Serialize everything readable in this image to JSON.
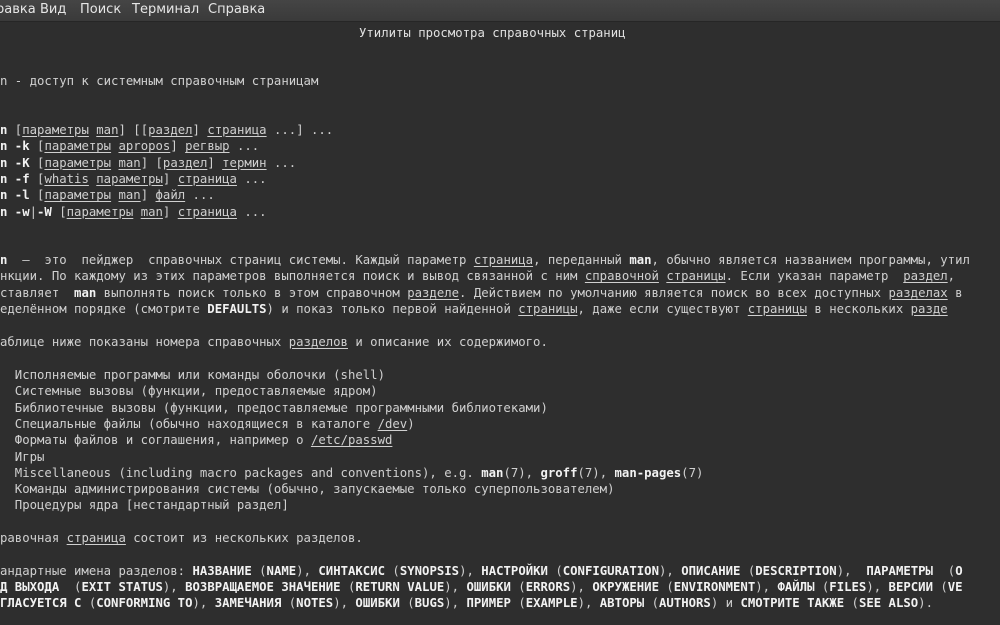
{
  "menu": {
    "items": [
      "равка",
      "Вид",
      "Поиск",
      "Терминал",
      "Справка"
    ]
  },
  "man": {
    "title": "Утилиты просмотра справочных страниц",
    "name_line": [
      {
        "t": "n - доступ к системным справочным страницам"
      }
    ],
    "synopsis": [
      [
        {
          "t": "n",
          "s": "b"
        },
        {
          "t": " ["
        },
        {
          "t": "параметры",
          "s": "u"
        },
        {
          "t": " "
        },
        {
          "t": "man",
          "s": "u"
        },
        {
          "t": "] [["
        },
        {
          "t": "раздел",
          "s": "u"
        },
        {
          "t": "] "
        },
        {
          "t": "страница",
          "s": "u"
        },
        {
          "t": " ...] ..."
        }
      ],
      [
        {
          "t": "n -k",
          "s": "b"
        },
        {
          "t": " ["
        },
        {
          "t": "параметры",
          "s": "u"
        },
        {
          "t": " "
        },
        {
          "t": "apropos",
          "s": "u"
        },
        {
          "t": "] "
        },
        {
          "t": "регвыр",
          "s": "u"
        },
        {
          "t": " ..."
        }
      ],
      [
        {
          "t": "n -K",
          "s": "b"
        },
        {
          "t": " ["
        },
        {
          "t": "параметры",
          "s": "u"
        },
        {
          "t": " "
        },
        {
          "t": "man",
          "s": "u"
        },
        {
          "t": "] ["
        },
        {
          "t": "раздел",
          "s": "u"
        },
        {
          "t": "] "
        },
        {
          "t": "термин",
          "s": "u"
        },
        {
          "t": " ..."
        }
      ],
      [
        {
          "t": "n -f",
          "s": "b"
        },
        {
          "t": " ["
        },
        {
          "t": "whatis",
          "s": "u"
        },
        {
          "t": " "
        },
        {
          "t": "параметры",
          "s": "u"
        },
        {
          "t": "] "
        },
        {
          "t": "страница",
          "s": "u"
        },
        {
          "t": " ..."
        }
      ],
      [
        {
          "t": "n -l",
          "s": "b"
        },
        {
          "t": " ["
        },
        {
          "t": "параметры",
          "s": "u"
        },
        {
          "t": " "
        },
        {
          "t": "man",
          "s": "u"
        },
        {
          "t": "] "
        },
        {
          "t": "файл",
          "s": "u"
        },
        {
          "t": " ..."
        }
      ],
      [
        {
          "t": "n -w",
          "s": "b"
        },
        {
          "t": "|"
        },
        {
          "t": "-W",
          "s": "b"
        },
        {
          "t": " ["
        },
        {
          "t": "параметры",
          "s": "u"
        },
        {
          "t": " "
        },
        {
          "t": "man",
          "s": "u"
        },
        {
          "t": "] "
        },
        {
          "t": "страница",
          "s": "u"
        },
        {
          "t": " ..."
        }
      ]
    ],
    "description": [
      [
        {
          "t": "n",
          "s": "b"
        },
        {
          "t": "  —  это  пейджер  справочных страниц системы. Каждый параметр "
        },
        {
          "t": "страница",
          "s": "u"
        },
        {
          "t": ", переданный "
        },
        {
          "t": "man",
          "s": "b"
        },
        {
          "t": ", обычно является названием программы, утил"
        }
      ],
      [
        {
          "t": "нкции. По каждому из этих параметров выполняется поиск и вывод связанной с ним "
        },
        {
          "t": "справочной",
          "s": "u"
        },
        {
          "t": " "
        },
        {
          "t": "страницы",
          "s": "u"
        },
        {
          "t": ". Если указан параметр  "
        },
        {
          "t": "раздел",
          "s": "u"
        },
        {
          "t": ", "
        }
      ],
      [
        {
          "t": "ставляет  "
        },
        {
          "t": "man",
          "s": "b"
        },
        {
          "t": " выполнять поиск только в этом справочном "
        },
        {
          "t": "разделе",
          "s": "u"
        },
        {
          "t": ". Действием по умолчанию является поиск во всех доступных "
        },
        {
          "t": "разделах",
          "s": "u"
        },
        {
          "t": " в"
        }
      ],
      [
        {
          "t": "еделённом порядке (смотрите "
        },
        {
          "t": "DEFAULTS",
          "s": "b"
        },
        {
          "t": ") и показ только первой найденной "
        },
        {
          "t": "страницы",
          "s": "u"
        },
        {
          "t": ", даже если существуют "
        },
        {
          "t": "страницы",
          "s": "u"
        },
        {
          "t": " в нескольких "
        },
        {
          "t": "разде",
          "s": "u"
        }
      ],
      [],
      [
        {
          "t": "аблице ниже показаны номера справочных "
        },
        {
          "t": "разделов",
          "s": "u"
        },
        {
          "t": " и описание их содержимого."
        }
      ]
    ],
    "sections": [
      [
        {
          "t": "  Исполняемые программы или команды оболочки (shell)"
        }
      ],
      [
        {
          "t": "  Системные вызовы (функции, предоставляемые ядром)"
        }
      ],
      [
        {
          "t": "  Библиотечные вызовы (функции, предоставляемые программными библиотеками)"
        }
      ],
      [
        {
          "t": "  Специальные файлы (обычно находящиеся в каталоге "
        },
        {
          "t": "/dev",
          "s": "u"
        },
        {
          "t": ")"
        }
      ],
      [
        {
          "t": "  Форматы файлов и соглашения, например о "
        },
        {
          "t": "/etc/passwd",
          "s": "u"
        }
      ],
      [
        {
          "t": "  Игры"
        }
      ],
      [
        {
          "t": "  Miscellaneous (including macro packages and conventions), e.g. "
        },
        {
          "t": "man",
          "s": "b"
        },
        {
          "t": "(7), "
        },
        {
          "t": "groff",
          "s": "b"
        },
        {
          "t": "(7), "
        },
        {
          "t": "man-pages",
          "s": "b"
        },
        {
          "t": "(7)"
        }
      ],
      [
        {
          "t": "  Команды администрирования системы (обычно, запускаемые только суперпользователем)"
        }
      ],
      [
        {
          "t": "  Процедуры ядра [нестандартный раздел]"
        }
      ]
    ],
    "footer": [
      [
        {
          "t": "равочная "
        },
        {
          "t": "страница",
          "s": "u"
        },
        {
          "t": " состоит из нескольких разделов."
        }
      ],
      [],
      [
        {
          "t": "андартные имена разделов: "
        },
        {
          "t": "НАЗВАНИЕ",
          "s": "b"
        },
        {
          "t": " ("
        },
        {
          "t": "NAME",
          "s": "b"
        },
        {
          "t": "), "
        },
        {
          "t": "СИНТАКСИС",
          "s": "b"
        },
        {
          "t": " ("
        },
        {
          "t": "SYNOPSIS",
          "s": "b"
        },
        {
          "t": "), "
        },
        {
          "t": "НАСТРОЙКИ",
          "s": "b"
        },
        {
          "t": " ("
        },
        {
          "t": "CONFIGURATION",
          "s": "b"
        },
        {
          "t": "), "
        },
        {
          "t": "ОПИСАНИЕ",
          "s": "b"
        },
        {
          "t": " ("
        },
        {
          "t": "DESCRIPTION",
          "s": "b"
        },
        {
          "t": "),  "
        },
        {
          "t": "ПАРАМЕТРЫ",
          "s": "b"
        },
        {
          "t": "  ("
        },
        {
          "t": "O",
          "s": "b"
        }
      ],
      [
        {
          "t": "Д ВЫХОДА",
          "s": "b"
        },
        {
          "t": "  ("
        },
        {
          "t": "EXIT STATUS",
          "s": "b"
        },
        {
          "t": "), "
        },
        {
          "t": "ВОЗВРАЩАЕМОЕ ЗНАЧЕНИЕ",
          "s": "b"
        },
        {
          "t": " ("
        },
        {
          "t": "RETURN VALUE",
          "s": "b"
        },
        {
          "t": "), "
        },
        {
          "t": "ОШИБКИ",
          "s": "b"
        },
        {
          "t": " ("
        },
        {
          "t": "ERRORS",
          "s": "b"
        },
        {
          "t": "), "
        },
        {
          "t": "ОКРУЖЕНИЕ",
          "s": "b"
        },
        {
          "t": " ("
        },
        {
          "t": "ENVIRONMENT",
          "s": "b"
        },
        {
          "t": "), "
        },
        {
          "t": "ФАЙЛЫ",
          "s": "b"
        },
        {
          "t": " ("
        },
        {
          "t": "FILES",
          "s": "b"
        },
        {
          "t": "), "
        },
        {
          "t": "ВЕРСИИ",
          "s": "b"
        },
        {
          "t": " ("
        },
        {
          "t": "VE",
          "s": "b"
        }
      ],
      [
        {
          "t": "ГЛАСУЕТСЯ С",
          "s": "b"
        },
        {
          "t": " ("
        },
        {
          "t": "CONFORMING TO",
          "s": "b"
        },
        {
          "t": "), "
        },
        {
          "t": "ЗАМЕЧАНИЯ",
          "s": "b"
        },
        {
          "t": " ("
        },
        {
          "t": "NOTES",
          "s": "b"
        },
        {
          "t": "), "
        },
        {
          "t": "ОШИБКИ",
          "s": "b"
        },
        {
          "t": " ("
        },
        {
          "t": "BUGS",
          "s": "b"
        },
        {
          "t": "), "
        },
        {
          "t": "ПРИМЕР",
          "s": "b"
        },
        {
          "t": " ("
        },
        {
          "t": "EXAMPLE",
          "s": "b"
        },
        {
          "t": "), "
        },
        {
          "t": "АВТОРЫ",
          "s": "b"
        },
        {
          "t": " ("
        },
        {
          "t": "AUTHORS",
          "s": "b"
        },
        {
          "t": ") и "
        },
        {
          "t": "СМОТРИТЕ ТАКЖЕ",
          "s": "b"
        },
        {
          "t": " ("
        },
        {
          "t": "SEE ALSO",
          "s": "b"
        },
        {
          "t": ")."
        }
      ]
    ]
  }
}
